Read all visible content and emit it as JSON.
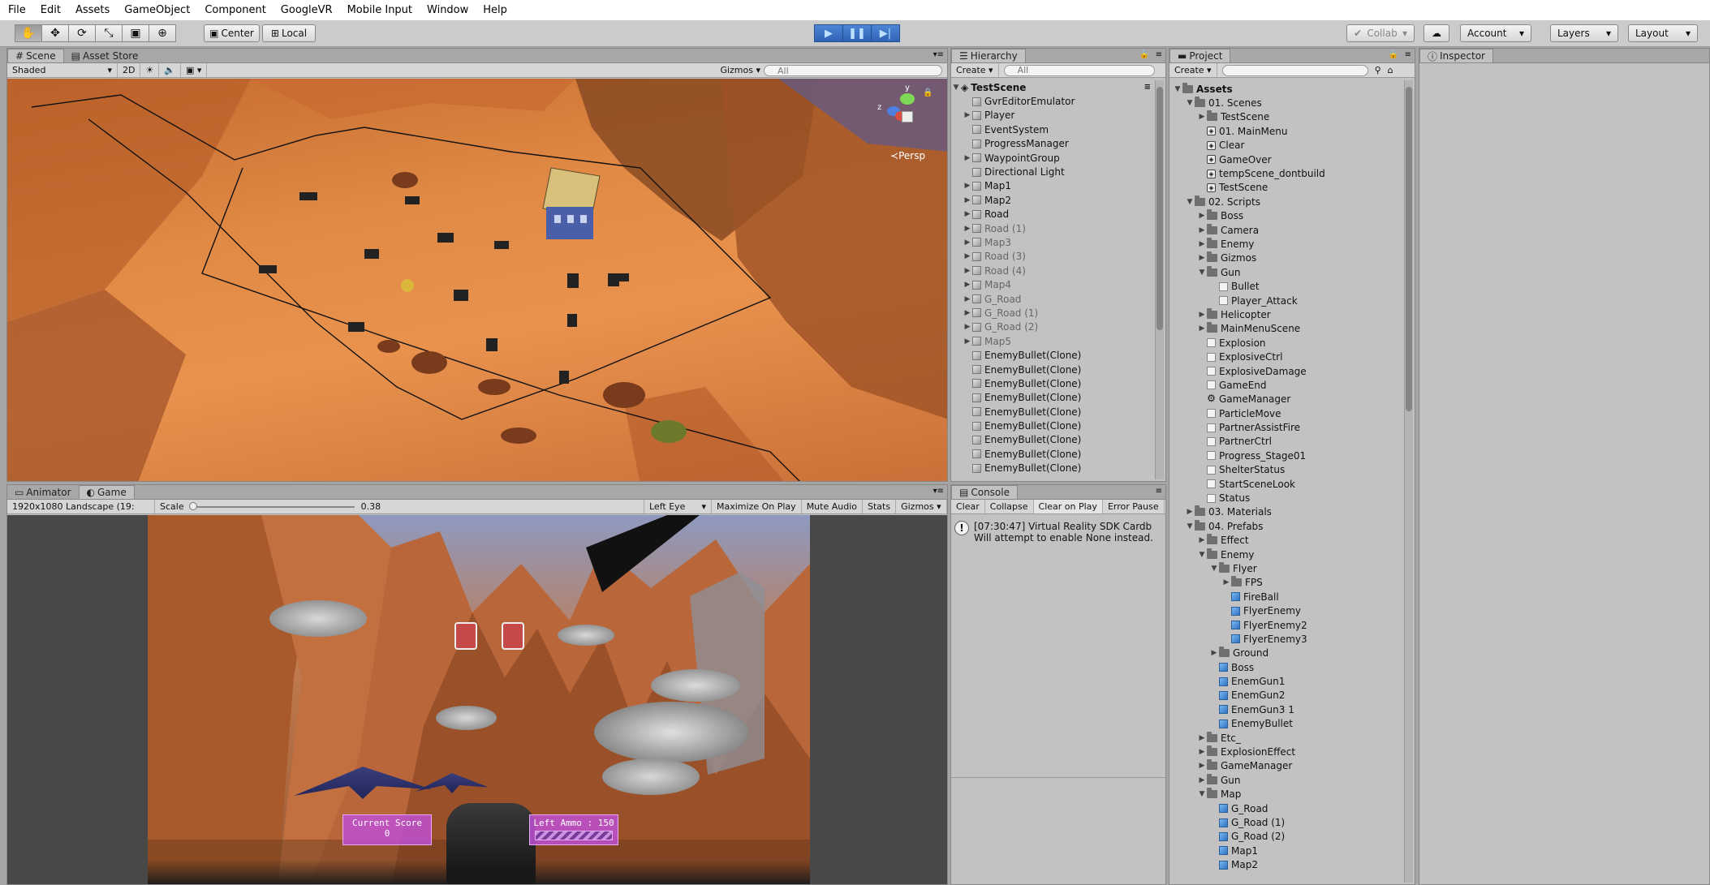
{
  "menu": [
    "File",
    "Edit",
    "Assets",
    "GameObject",
    "Component",
    "GoogleVR",
    "Mobile Input",
    "Window",
    "Help"
  ],
  "toolbar": {
    "pivot": "Center",
    "space": "Local",
    "collab": "Collab",
    "account": "Account",
    "layers": "Layers",
    "layout": "Layout"
  },
  "scene_panel": {
    "tabs": [
      "Scene",
      "Asset Store"
    ],
    "shading": "Shaded",
    "mode2d": "2D",
    "gizmos": "Gizmos",
    "search_placeholder": "All",
    "persp": "Persp",
    "axis_y": "y",
    "axis_z": "z"
  },
  "game_panel": {
    "tabs": [
      "Animator",
      "Game"
    ],
    "resolution": "1920x1080 Landscape (19:",
    "scale_label": "Scale",
    "scale_value": "0.38",
    "eye": "Left Eye",
    "maximize": "Maximize On Play",
    "mute": "Mute Audio",
    "stats": "Stats",
    "gizmos": "Gizmos",
    "score_label": "Current Score",
    "score_value": "0",
    "ammo_label": "Left Ammo : 150",
    "ammo_fraction": 1.0
  },
  "hierarchy": {
    "tab": "Hierarchy",
    "create": "Create",
    "search_placeholder": "All",
    "scene": "TestScene",
    "items": [
      {
        "label": "GvrEditorEmulator",
        "arrow": false,
        "dim": false
      },
      {
        "label": "Player",
        "arrow": true,
        "dim": false
      },
      {
        "label": "EventSystem",
        "arrow": false,
        "dim": false
      },
      {
        "label": "ProgressManager",
        "arrow": false,
        "dim": false
      },
      {
        "label": "WaypointGroup",
        "arrow": true,
        "dim": false
      },
      {
        "label": "Directional Light",
        "arrow": false,
        "dim": false
      },
      {
        "label": "Map1",
        "arrow": true,
        "dim": false
      },
      {
        "label": "Map2",
        "arrow": true,
        "dim": false
      },
      {
        "label": "Road",
        "arrow": true,
        "dim": false
      },
      {
        "label": "Road (1)",
        "arrow": true,
        "dim": true
      },
      {
        "label": "Map3",
        "arrow": true,
        "dim": true
      },
      {
        "label": "Road (3)",
        "arrow": true,
        "dim": true
      },
      {
        "label": "Road (4)",
        "arrow": true,
        "dim": true
      },
      {
        "label": "Map4",
        "arrow": true,
        "dim": true
      },
      {
        "label": "G_Road",
        "arrow": true,
        "dim": true
      },
      {
        "label": "G_Road (1)",
        "arrow": true,
        "dim": true
      },
      {
        "label": "G_Road (2)",
        "arrow": true,
        "dim": true
      },
      {
        "label": "Map5",
        "arrow": true,
        "dim": true
      },
      {
        "label": "EnemyBullet(Clone)",
        "arrow": false,
        "dim": false
      },
      {
        "label": "EnemyBullet(Clone)",
        "arrow": false,
        "dim": false
      },
      {
        "label": "EnemyBullet(Clone)",
        "arrow": false,
        "dim": false
      },
      {
        "label": "EnemyBullet(Clone)",
        "arrow": false,
        "dim": false
      },
      {
        "label": "EnemyBullet(Clone)",
        "arrow": false,
        "dim": false
      },
      {
        "label": "EnemyBullet(Clone)",
        "arrow": false,
        "dim": false
      },
      {
        "label": "EnemyBullet(Clone)",
        "arrow": false,
        "dim": false
      },
      {
        "label": "EnemyBullet(Clone)",
        "arrow": false,
        "dim": false
      },
      {
        "label": "EnemyBullet(Clone)",
        "arrow": false,
        "dim": false
      }
    ]
  },
  "console": {
    "tab": "Console",
    "buttons": [
      "Clear",
      "Collapse",
      "Clear on Play",
      "Error Pause"
    ],
    "message_line1": "[07:30:47] Virtual Reality SDK Cardb",
    "message_line2": "Will attempt to enable None instead."
  },
  "project": {
    "tab": "Project",
    "create": "Create",
    "items": [
      {
        "label": "Assets",
        "depth": 0,
        "arrow": "down",
        "icon": "folder",
        "bold": true
      },
      {
        "label": "01. Scenes",
        "depth": 1,
        "arrow": "down",
        "icon": "folder"
      },
      {
        "label": "TestScene",
        "depth": 2,
        "arrow": "right",
        "icon": "folder"
      },
      {
        "label": "01. MainMenu",
        "depth": 2,
        "arrow": "none",
        "icon": "scene"
      },
      {
        "label": "Clear",
        "depth": 2,
        "arrow": "none",
        "icon": "scene"
      },
      {
        "label": "GameOver",
        "depth": 2,
        "arrow": "none",
        "icon": "scene"
      },
      {
        "label": "tempScene_dontbuild",
        "depth": 2,
        "arrow": "none",
        "icon": "scene"
      },
      {
        "label": "TestScene",
        "depth": 2,
        "arrow": "none",
        "icon": "scene"
      },
      {
        "label": "02. Scripts",
        "depth": 1,
        "arrow": "down",
        "icon": "folder"
      },
      {
        "label": "Boss",
        "depth": 2,
        "arrow": "right",
        "icon": "folder"
      },
      {
        "label": "Camera",
        "depth": 2,
        "arrow": "right",
        "icon": "folder"
      },
      {
        "label": "Enemy",
        "depth": 2,
        "arrow": "right",
        "icon": "folder"
      },
      {
        "label": "Gizmos",
        "depth": 2,
        "arrow": "right",
        "icon": "folder"
      },
      {
        "label": "Gun",
        "depth": 2,
        "arrow": "down",
        "icon": "folder"
      },
      {
        "label": "Bullet",
        "depth": 3,
        "arrow": "none",
        "icon": "script"
      },
      {
        "label": "Player_Attack",
        "depth": 3,
        "arrow": "none",
        "icon": "script"
      },
      {
        "label": "Helicopter",
        "depth": 2,
        "arrow": "right",
        "icon": "folder"
      },
      {
        "label": "MainMenuScene",
        "depth": 2,
        "arrow": "right",
        "icon": "folder"
      },
      {
        "label": "Explosion",
        "depth": 2,
        "arrow": "none",
        "icon": "script"
      },
      {
        "label": "ExplosiveCtrl",
        "depth": 2,
        "arrow": "none",
        "icon": "script"
      },
      {
        "label": "ExplosiveDamage",
        "depth": 2,
        "arrow": "none",
        "icon": "script"
      },
      {
        "label": "GameEnd",
        "depth": 2,
        "arrow": "none",
        "icon": "script"
      },
      {
        "label": "GameManager",
        "depth": 2,
        "arrow": "none",
        "icon": "gear"
      },
      {
        "label": "ParticleMove",
        "depth": 2,
        "arrow": "none",
        "icon": "script"
      },
      {
        "label": "PartnerAssistFire",
        "depth": 2,
        "arrow": "none",
        "icon": "script"
      },
      {
        "label": "PartnerCtrl",
        "depth": 2,
        "arrow": "none",
        "icon": "script"
      },
      {
        "label": "Progress_Stage01",
        "depth": 2,
        "arrow": "none",
        "icon": "script"
      },
      {
        "label": "ShelterStatus",
        "depth": 2,
        "arrow": "none",
        "icon": "script"
      },
      {
        "label": "StartSceneLook",
        "depth": 2,
        "arrow": "none",
        "icon": "script"
      },
      {
        "label": "Status",
        "depth": 2,
        "arrow": "none",
        "icon": "script"
      },
      {
        "label": "03. Materials",
        "depth": 1,
        "arrow": "right",
        "icon": "folder"
      },
      {
        "label": "04. Prefabs",
        "depth": 1,
        "arrow": "down",
        "icon": "folder"
      },
      {
        "label": "Effect",
        "depth": 2,
        "arrow": "right",
        "icon": "folder"
      },
      {
        "label": "Enemy",
        "depth": 2,
        "arrow": "down",
        "icon": "folder"
      },
      {
        "label": "Flyer",
        "depth": 3,
        "arrow": "down",
        "icon": "folder"
      },
      {
        "label": "FPS",
        "depth": 4,
        "arrow": "right",
        "icon": "folder"
      },
      {
        "label": "FireBall",
        "depth": 4,
        "arrow": "none",
        "icon": "prefab"
      },
      {
        "label": "FlyerEnemy",
        "depth": 4,
        "arrow": "none",
        "icon": "prefab"
      },
      {
        "label": "FlyerEnemy2",
        "depth": 4,
        "arrow": "none",
        "icon": "prefab"
      },
      {
        "label": "FlyerEnemy3",
        "depth": 4,
        "arrow": "none",
        "icon": "prefab"
      },
      {
        "label": "Ground",
        "depth": 3,
        "arrow": "right",
        "icon": "folder"
      },
      {
        "label": "Boss",
        "depth": 3,
        "arrow": "none",
        "icon": "prefab"
      },
      {
        "label": "EnemGun1",
        "depth": 3,
        "arrow": "none",
        "icon": "prefab"
      },
      {
        "label": "EnemGun2",
        "depth": 3,
        "arrow": "none",
        "icon": "prefab"
      },
      {
        "label": "EnemGun3 1",
        "depth": 3,
        "arrow": "none",
        "icon": "prefab"
      },
      {
        "label": "EnemyBullet",
        "depth": 3,
        "arrow": "none",
        "icon": "prefab"
      },
      {
        "label": "Etc_",
        "depth": 2,
        "arrow": "right",
        "icon": "folder"
      },
      {
        "label": "ExplosionEffect",
        "depth": 2,
        "arrow": "right",
        "icon": "folder"
      },
      {
        "label": "GameManager",
        "depth": 2,
        "arrow": "right",
        "icon": "folder"
      },
      {
        "label": "Gun",
        "depth": 2,
        "arrow": "right",
        "icon": "folder"
      },
      {
        "label": "Map",
        "depth": 2,
        "arrow": "down",
        "icon": "folder"
      },
      {
        "label": "G_Road",
        "depth": 3,
        "arrow": "none",
        "icon": "prefab"
      },
      {
        "label": "G_Road (1)",
        "depth": 3,
        "arrow": "none",
        "icon": "prefab"
      },
      {
        "label": "G_Road (2)",
        "depth": 3,
        "arrow": "none",
        "icon": "prefab"
      },
      {
        "label": "Map1",
        "depth": 3,
        "arrow": "none",
        "icon": "prefab"
      },
      {
        "label": "Map2",
        "depth": 3,
        "arrow": "none",
        "icon": "prefab"
      }
    ]
  },
  "inspector": {
    "tab": "Inspector"
  }
}
